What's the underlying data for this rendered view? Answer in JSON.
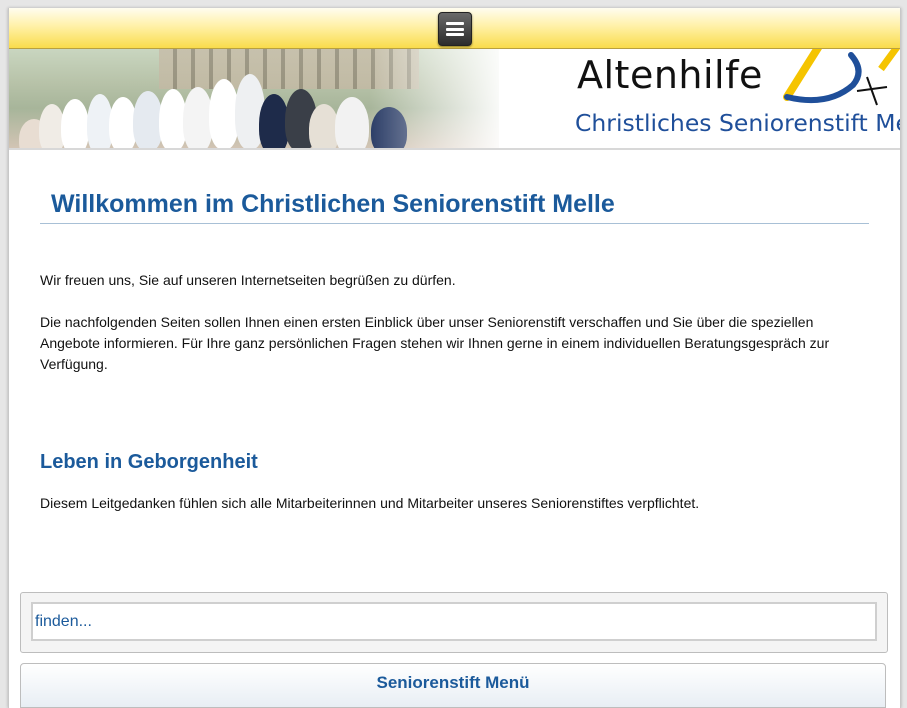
{
  "topbar": {
    "menu_icon": "hamburger-menu-icon"
  },
  "header": {
    "logo_title": "Altenhilfe",
    "logo_subtitle": "Christliches Seniorenstift Melle",
    "colors": {
      "logo_blue": "#1f4f9a",
      "logo_yellow": "#f5c400",
      "title_black": "#111111"
    }
  },
  "content": {
    "title": "Willkommen im Christlichen Seniorenstift Melle",
    "paragraphs": [
      "Wir freuen uns, Sie auf unseren Internetseiten begrüßen zu dürfen.",
      "Die nachfolgenden Seiten sollen Ihnen einen ersten Einblick über unser Seniorenstift verschaffen und Sie über die speziellen Angebote informieren. Für Ihre ganz persönlichen Fragen stehen wir Ihnen gerne in einem individuellen Beratungsgespräch zur Verfügung."
    ],
    "section": {
      "heading": "Leben in Geborgenheit",
      "text": "Diesem Leitgedanken fühlen sich alle Mitarbeiterinnen und Mitarbeiter unseres Seniorenstiftes verpflichtet."
    }
  },
  "search": {
    "placeholder": "finden..."
  },
  "menu": {
    "label": "Seniorenstift Menü"
  },
  "colors": {
    "accent": "#1b5a9b",
    "topbar_yellow": "#f9dc4c"
  }
}
